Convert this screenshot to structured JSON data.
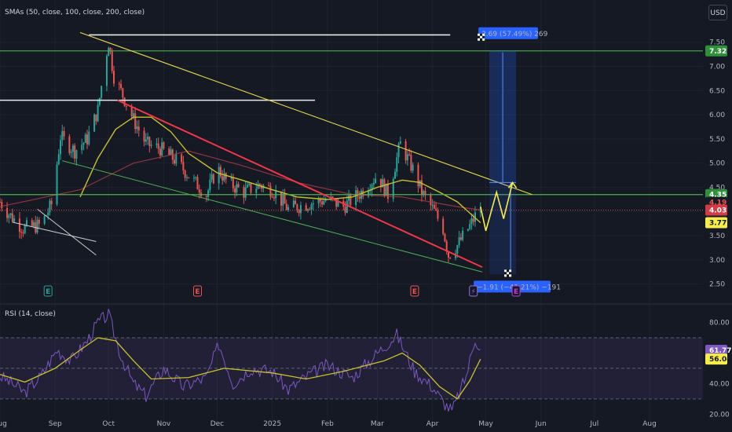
{
  "header": {
    "price_indicator_label": "SMAs (50, close, 100, close, 200, close)",
    "rsi_indicator_label": "RSI (14, close)",
    "currency_button": "USD"
  },
  "colors": {
    "background": "#151924",
    "up_candle": "#26a69a",
    "down_candle": "#ef5350",
    "sma50": "#c9c12a",
    "sma100": "#b23a48",
    "rsi_line": "#7e57c2",
    "rsi_ma": "#c9c12a",
    "green_line": "#4caf50",
    "yellow_line": "#e6d84a",
    "pink_line": "#f23645",
    "projection": "#2962ff"
  },
  "chart_data": [
    {
      "type": "candlestick",
      "pane": "price",
      "ylim": [
        2.3,
        7.95
      ],
      "yticks": [
        "7.50",
        "7.00",
        "6.50",
        "6.00",
        "5.50",
        "5.00",
        "4.50",
        "4.00",
        "3.50",
        "3.00",
        "2.50"
      ],
      "x_domain": [
        "2024-08-01",
        "2025-08-31"
      ],
      "xticks": [
        {
          "label": "Aug",
          "date": "2024-08-01"
        },
        {
          "label": "Sep",
          "date": "2024-09-01"
        },
        {
          "label": "Oct",
          "date": "2024-10-01"
        },
        {
          "label": "Nov",
          "date": "2024-11-01"
        },
        {
          "label": "Dec",
          "date": "2024-12-01"
        },
        {
          "label": "2025",
          "date": "2025-01-01"
        },
        {
          "label": "Feb",
          "date": "2025-02-01"
        },
        {
          "label": "Mar",
          "date": "2025-03-01"
        },
        {
          "label": "Apr",
          "date": "2025-04-01"
        },
        {
          "label": "May",
          "date": "2025-05-01"
        },
        {
          "label": "Jun",
          "date": "2025-06-01"
        },
        {
          "label": "Jul",
          "date": "2025-07-01"
        },
        {
          "label": "Aug",
          "date": "2025-08-01"
        }
      ],
      "price_path": [
        [
          "2024-08-01",
          4.2
        ],
        [
          "2024-08-06",
          3.95
        ],
        [
          "2024-08-14",
          3.65
        ],
        [
          "2024-08-24",
          3.72
        ],
        [
          "2024-08-30",
          4.15
        ],
        [
          "2024-09-04",
          5.55
        ],
        [
          "2024-09-12",
          5.25
        ],
        [
          "2024-09-19",
          5.5
        ],
        [
          "2024-09-25",
          6.1
        ],
        [
          "2024-09-29",
          7.1
        ],
        [
          "2024-10-01",
          7.5
        ],
        [
          "2024-10-04",
          6.8
        ],
        [
          "2024-10-09",
          6.4
        ],
        [
          "2024-10-15",
          5.9
        ],
        [
          "2024-10-22",
          5.4
        ],
        [
          "2024-10-30",
          5.3
        ],
        [
          "2024-11-08",
          5.05
        ],
        [
          "2024-11-16",
          4.7
        ],
        [
          "2024-11-25",
          4.35
        ],
        [
          "2024-12-01",
          4.9
        ],
        [
          "2024-12-07",
          4.6
        ],
        [
          "2024-12-16",
          4.4
        ],
        [
          "2024-12-25",
          4.55
        ],
        [
          "2025-01-01",
          4.45
        ],
        [
          "2025-01-10",
          4.05
        ],
        [
          "2025-01-20",
          4.15
        ],
        [
          "2025-02-01",
          4.25
        ],
        [
          "2025-02-10",
          4.1
        ],
        [
          "2025-02-20",
          4.4
        ],
        [
          "2025-03-01",
          4.75
        ],
        [
          "2025-03-07",
          4.35
        ],
        [
          "2025-03-14",
          5.4
        ],
        [
          "2025-03-18",
          5.1
        ],
        [
          "2025-03-22",
          4.8
        ],
        [
          "2025-03-26",
          4.4
        ],
        [
          "2025-04-02",
          4.0
        ],
        [
          "2025-04-07",
          3.65
        ],
        [
          "2025-04-10",
          3.1
        ],
        [
          "2025-04-15",
          3.3
        ],
        [
          "2025-04-22",
          3.7
        ],
        [
          "2025-04-28",
          4.1
        ]
      ],
      "sma50": [
        [
          "2024-09-15",
          4.3
        ],
        [
          "2024-09-25",
          5.1
        ],
        [
          "2024-10-05",
          5.7
        ],
        [
          "2024-10-15",
          5.95
        ],
        [
          "2024-10-25",
          5.95
        ],
        [
          "2024-11-05",
          5.65
        ],
        [
          "2024-11-15",
          5.2
        ],
        [
          "2024-12-01",
          4.8
        ],
        [
          "2024-12-15",
          4.65
        ],
        [
          "2025-01-01",
          4.45
        ],
        [
          "2025-01-15",
          4.3
        ],
        [
          "2025-02-01",
          4.25
        ],
        [
          "2025-02-15",
          4.3
        ],
        [
          "2025-03-01",
          4.5
        ],
        [
          "2025-03-15",
          4.65
        ],
        [
          "2025-03-25",
          4.6
        ],
        [
          "2025-04-05",
          4.4
        ],
        [
          "2025-04-15",
          4.2
        ],
        [
          "2025-04-28",
          3.77
        ]
      ],
      "sma100": [
        [
          "2024-08-01",
          4.1
        ],
        [
          "2024-09-15",
          4.45
        ],
        [
          "2024-10-15",
          5.0
        ],
        [
          "2024-11-15",
          5.25
        ],
        [
          "2024-12-15",
          4.95
        ],
        [
          "2025-01-15",
          4.6
        ],
        [
          "2025-02-15",
          4.35
        ],
        [
          "2025-03-15",
          4.3
        ],
        [
          "2025-04-15",
          4.1
        ],
        [
          "2025-04-28",
          4.03
        ]
      ],
      "drawings": {
        "white_lines": [
          {
            "from": [
              "2024-09-20",
              7.65
            ],
            "to": [
              "2025-04-11",
              7.65
            ]
          },
          {
            "from": [
              "2024-08-01",
              6.3
            ],
            "to": [
              "2025-01-25",
              6.3
            ]
          }
        ],
        "green_horizontal_lines": [
          7.32,
          4.35
        ],
        "yellow_channel_top": {
          "from": [
            "2024-09-15",
            7.7
          ],
          "to": [
            "2025-05-27",
            4.35
          ]
        },
        "pink_trendline": {
          "from": [
            "2024-10-06",
            6.3
          ],
          "to": [
            "2025-04-29",
            2.85
          ]
        },
        "green_channel_bottom": {
          "from": [
            "2024-09-05",
            5.05
          ],
          "to": [
            "2025-04-29",
            2.75
          ]
        },
        "small_white_lines": [
          {
            "from": [
              "2024-08-08",
              3.78
            ],
            "to": [
              "2024-09-24",
              3.38
            ]
          },
          {
            "from": [
              "2024-08-22",
              4.05
            ],
            "to": [
              "2024-09-24",
              3.1
            ]
          }
        ],
        "dashed_level": 4.03,
        "zigzag_projection": [
          [
            "2025-04-28",
            4.1
          ],
          [
            "2025-05-01",
            3.6
          ],
          [
            "2025-05-07",
            4.4
          ],
          [
            "2025-05-11",
            3.85
          ],
          [
            "2025-05-16",
            4.6
          ]
        ],
        "projection_box": {
          "from_date": "2025-05-03",
          "to_date": "2025-05-18",
          "top": 7.32,
          "bottom": 2.7,
          "split": 4.6
        },
        "long_label": "2.69 (57.49%) 269",
        "short_label": "−1.91 (−41.21%) −191"
      },
      "events": [
        {
          "letter": "E",
          "date": "2024-08-28",
          "color": "#26a69a"
        },
        {
          "letter": "E",
          "date": "2024-11-20",
          "color": "#ef5350"
        },
        {
          "letter": "E",
          "date": "2025-03-22",
          "color": "#ef5350"
        },
        {
          "letter": "⚡",
          "date": "2025-04-24",
          "color": "#9c6ade"
        },
        {
          "letter": "E",
          "date": "2025-05-18",
          "color": "#c13bd6"
        }
      ],
      "price_tags": [
        {
          "value": 7.32,
          "text": "7.32",
          "bg": "#2f8f3a",
          "fg": "#ffffff"
        },
        {
          "value": 4.35,
          "text": "4.35",
          "bg": "#2f8f3a",
          "fg": "#ffffff"
        },
        {
          "value": 4.19,
          "text": "4.19",
          "bg": "#161a25",
          "fg": "#ef5350"
        },
        {
          "value": 4.03,
          "text": "4.03",
          "bg": "#d23c45",
          "fg": "#ffffff"
        },
        {
          "value": 3.77,
          "text": "3.77",
          "bg": "#f7ed4a",
          "fg": "#131722"
        }
      ]
    },
    {
      "type": "line",
      "pane": "rsi",
      "ylim": [
        15,
        88
      ],
      "yticks": [
        "80.00",
        "40.00",
        "20.00"
      ],
      "band": [
        30,
        70
      ],
      "rsi": [
        [
          "2024-08-01",
          45
        ],
        [
          "2024-08-08",
          40
        ],
        [
          "2024-08-15",
          34
        ],
        [
          "2024-08-24",
          45
        ],
        [
          "2024-09-02",
          62
        ],
        [
          "2024-09-10",
          55
        ],
        [
          "2024-09-19",
          68
        ],
        [
          "2024-09-25",
          80
        ],
        [
          "2024-10-01",
          85
        ],
        [
          "2024-10-08",
          58
        ],
        [
          "2024-10-15",
          40
        ],
        [
          "2024-10-22",
          32
        ],
        [
          "2024-11-01",
          50
        ],
        [
          "2024-11-12",
          38
        ],
        [
          "2024-11-25",
          44
        ],
        [
          "2024-12-02",
          66
        ],
        [
          "2024-12-10",
          40
        ],
        [
          "2024-12-20",
          50
        ],
        [
          "2025-01-01",
          48
        ],
        [
          "2025-01-10",
          36
        ],
        [
          "2025-01-22",
          46
        ],
        [
          "2025-02-01",
          52
        ],
        [
          "2025-02-15",
          44
        ],
        [
          "2025-03-01",
          60
        ],
        [
          "2025-03-12",
          72
        ],
        [
          "2025-03-22",
          48
        ],
        [
          "2025-04-01",
          38
        ],
        [
          "2025-04-07",
          28
        ],
        [
          "2025-04-12",
          22
        ],
        [
          "2025-04-20",
          45
        ],
        [
          "2025-04-25",
          70
        ],
        [
          "2025-04-28",
          61.77
        ]
      ],
      "rsi_ma": [
        [
          "2024-08-01",
          46
        ],
        [
          "2024-08-15",
          41
        ],
        [
          "2024-09-01",
          50
        ],
        [
          "2024-09-15",
          62
        ],
        [
          "2024-09-25",
          70
        ],
        [
          "2024-10-05",
          68
        ],
        [
          "2024-10-15",
          55
        ],
        [
          "2024-10-25",
          43
        ],
        [
          "2024-11-15",
          44
        ],
        [
          "2024-12-05",
          50
        ],
        [
          "2025-01-01",
          47
        ],
        [
          "2025-01-20",
          43
        ],
        [
          "2025-02-10",
          48
        ],
        [
          "2025-03-05",
          55
        ],
        [
          "2025-03-15",
          60
        ],
        [
          "2025-03-25",
          52
        ],
        [
          "2025-04-05",
          38
        ],
        [
          "2025-04-15",
          30
        ],
        [
          "2025-04-22",
          42
        ],
        [
          "2025-04-28",
          56.04
        ]
      ],
      "tags": [
        {
          "value": 61.77,
          "text": "61.77",
          "bg": "#7e57c2",
          "fg": "#ffffff"
        },
        {
          "value": 56.04,
          "text": "56.04",
          "bg": "#f7ed4a",
          "fg": "#131722"
        }
      ]
    }
  ]
}
